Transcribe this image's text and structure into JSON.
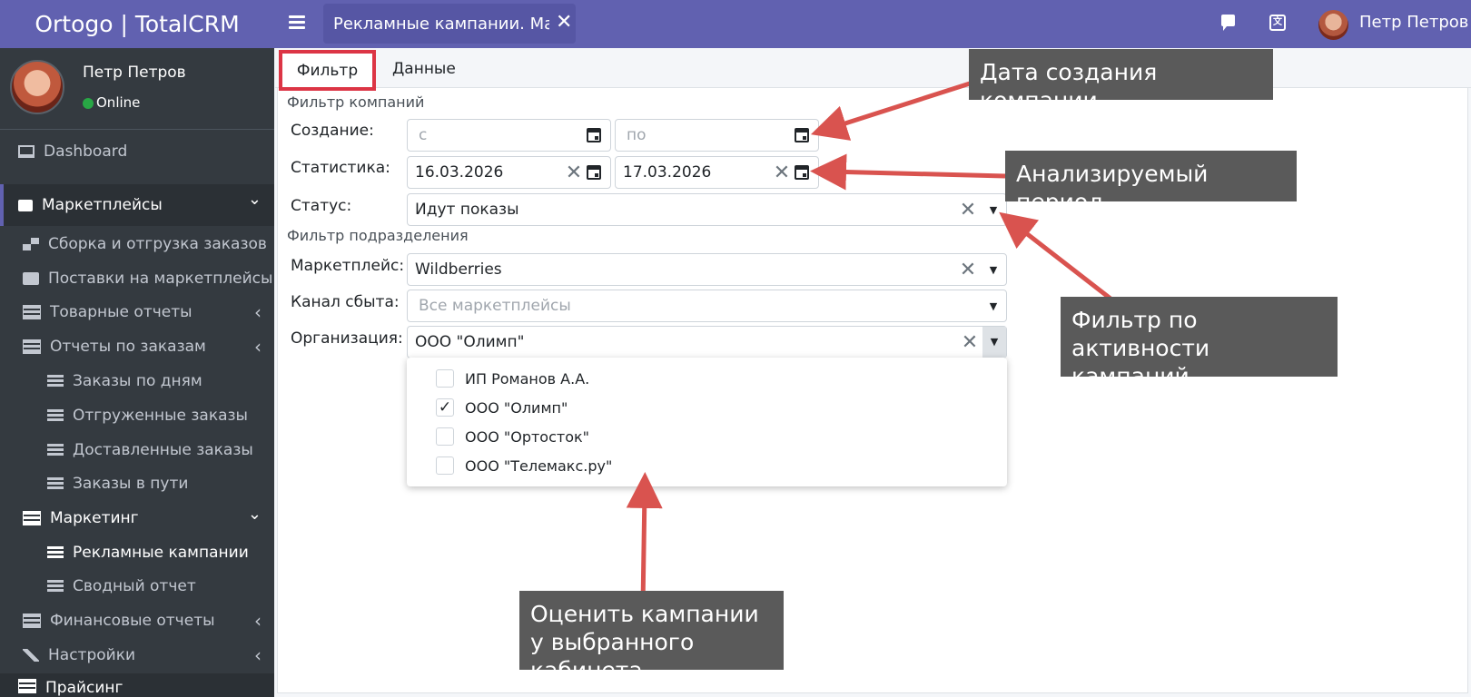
{
  "header": {
    "brand": "Ortogo | TotalCRM",
    "tab_title": "Рекламные кампании. Ма...",
    "tab_close": "✕",
    "user_name": "Петр Петров",
    "translate_glyph": "文"
  },
  "sidebar": {
    "user_name": "Петр Петров",
    "status": "Online",
    "items": [
      {
        "label": "Dashboard"
      },
      {
        "label": "Маркетплейсы"
      },
      {
        "label": "Сборка и отгрузка заказов"
      },
      {
        "label": "Поставки на маркетплейсы"
      },
      {
        "label": "Товарные отчеты"
      },
      {
        "label": "Отчеты по заказам"
      },
      {
        "label": "Заказы по дням"
      },
      {
        "label": "Отгруженные заказы"
      },
      {
        "label": "Доставленные заказы"
      },
      {
        "label": "Заказы в пути"
      },
      {
        "label": "Маркетинг"
      },
      {
        "label": "Рекламные кампании"
      },
      {
        "label": "Сводный отчет"
      },
      {
        "label": "Финансовые отчеты"
      },
      {
        "label": "Настройки"
      },
      {
        "label": "Прайсинг"
      }
    ],
    "chevron_down": "⌄",
    "chevron_left": "‹"
  },
  "tabs": {
    "filter": "Фильтр",
    "data": "Данные"
  },
  "filter": {
    "section_campaigns": "Фильтр компаний",
    "creation_label": "Создание:",
    "creation_from_placeholder": "с",
    "creation_to_placeholder": "по",
    "stats_label": "Статистика:",
    "stats_from": "16.03.2026",
    "stats_to": "17.03.2026",
    "status_label": "Статус:",
    "status_value": "Идут показы",
    "section_division": "Фильтр подразделения",
    "marketplace_label": "Маркетплейс:",
    "marketplace_value": "Wildberries",
    "channel_label": "Канал сбыта:",
    "channel_placeholder": "Все маркетплейсы",
    "org_label": "Организация:",
    "org_value": "ООО \"Олимп\"",
    "clear_glyph": "✕",
    "caret_glyph": "▼"
  },
  "org_options": [
    {
      "label": "ИП Романов А.А.",
      "checked": false
    },
    {
      "label": "ООО \"Олимп\"",
      "checked": true
    },
    {
      "label": "ООО \"Ортосток\"",
      "checked": false
    },
    {
      "label": "ООО \"Телемакс.ру\"",
      "checked": false
    }
  ],
  "annotations": {
    "creation_date": "Дата создания компании",
    "period": "Анализируемый период",
    "activity_filter": "Фильтр по активности кампаний",
    "evaluate_cabinet": "Оценить кампании у выбранного кабинета"
  },
  "colors": {
    "header": "#6161b0",
    "sidebar": "#343a40",
    "highlight": "#dc3545",
    "arrow": "#d9534f",
    "note_bg": "#5a5a5a"
  }
}
